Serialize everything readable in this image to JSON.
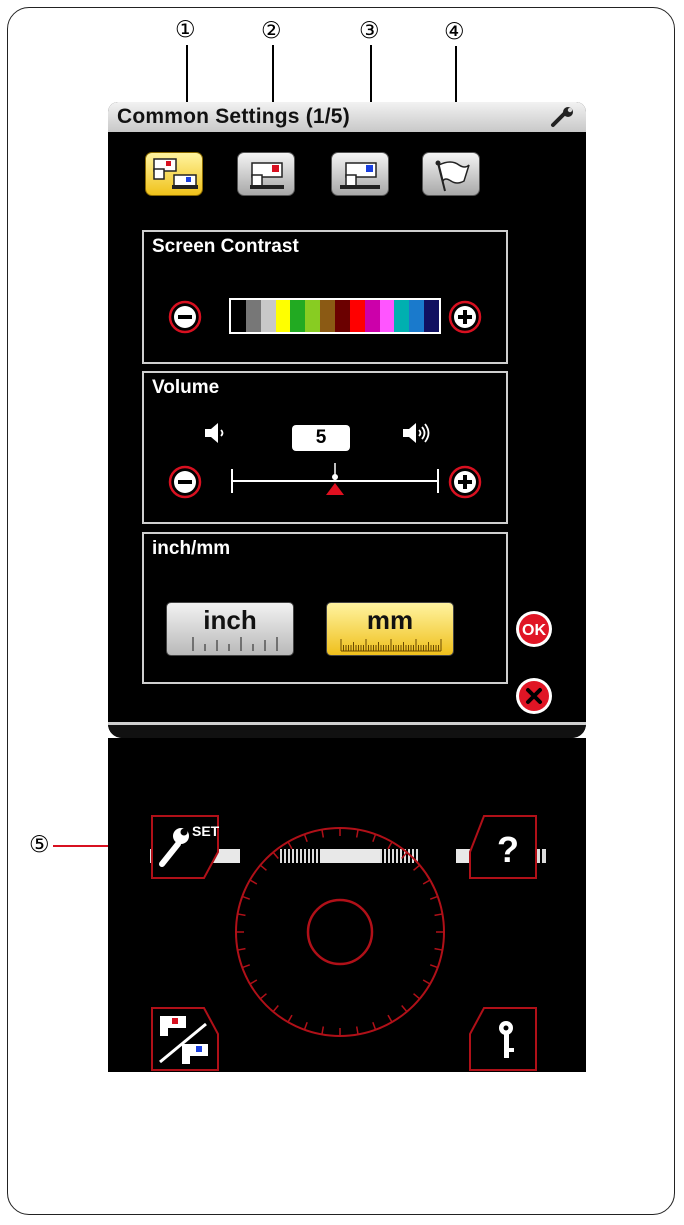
{
  "callouts": {
    "c1": "①",
    "c2": "②",
    "c3": "③",
    "c4": "④",
    "c5": "⑤"
  },
  "screen": {
    "title": "Common Settings (1/5)",
    "tabs": [
      {
        "icon": "common-settings-icon",
        "active": true
      },
      {
        "icon": "sewing-settings-icon",
        "active": false
      },
      {
        "icon": "embroidery-settings-icon",
        "active": false
      },
      {
        "icon": "language-flag-icon",
        "active": false
      }
    ],
    "contrast": {
      "title": "Screen Contrast",
      "colors": [
        "#000000",
        "#777777",
        "#c8c8c8",
        "#ffff00",
        "#22aa22",
        "#88cc22",
        "#8b5a14",
        "#6b0000",
        "#ff0000",
        "#cc00aa",
        "#ff55ff",
        "#00b0b0",
        "#1a7acc",
        "#101060"
      ]
    },
    "volume": {
      "title": "Volume",
      "value": "5",
      "level_fraction": 0.5
    },
    "units": {
      "title": "inch/mm",
      "inch_label": "inch",
      "mm_label": "mm",
      "selected": "mm"
    },
    "ok_label": "OK",
    "accent_red": "#d81020",
    "active_yellow": "#f0c21a"
  },
  "lower_panel": {
    "set_label": "SET",
    "help_label": "?",
    "icons": [
      "speed-down-icon",
      "speed-up-icon",
      "set-wrench-icon",
      "help-icon",
      "mode-switch-icon",
      "lock-key-icon",
      "jog-dial-icon"
    ]
  }
}
